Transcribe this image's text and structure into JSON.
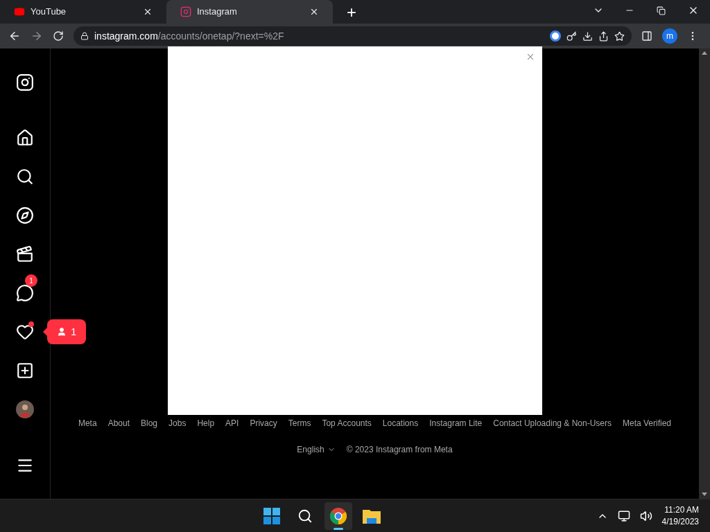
{
  "browser": {
    "tabs": [
      {
        "title": "YouTube",
        "kind": "youtube",
        "selected": false
      },
      {
        "title": "Instagram",
        "kind": "instagram",
        "selected": true
      }
    ],
    "new_tab": "+",
    "url": {
      "host": "instagram.com",
      "path": "/accounts/onetap/?next=%2F"
    },
    "profile": "m"
  },
  "sidebar": {
    "items": [
      {
        "kind": "logo"
      },
      {
        "kind": "home"
      },
      {
        "kind": "search"
      },
      {
        "kind": "explore"
      },
      {
        "kind": "reels"
      },
      {
        "kind": "messages",
        "badge": "1"
      },
      {
        "kind": "notifications",
        "dot": true,
        "tooltip": "1"
      },
      {
        "kind": "create"
      },
      {
        "kind": "profile"
      },
      {
        "kind": "menu"
      }
    ]
  },
  "modal": {
    "open": true
  },
  "footer": {
    "links": [
      "Meta",
      "About",
      "Blog",
      "Jobs",
      "Help",
      "API",
      "Privacy",
      "Terms",
      "Top Accounts",
      "Locations",
      "Instagram Lite",
      "Contact Uploading & Non-Users",
      "Meta Verified"
    ],
    "language": "English",
    "copyright": "© 2023 Instagram from Meta"
  },
  "taskbar": {
    "apps": [
      {
        "kind": "start",
        "selected": false
      },
      {
        "kind": "search",
        "selected": false
      },
      {
        "kind": "chrome",
        "selected": true
      },
      {
        "kind": "files",
        "selected": false
      }
    ],
    "time": "11:20 AM",
    "date": "4/19/2023"
  }
}
